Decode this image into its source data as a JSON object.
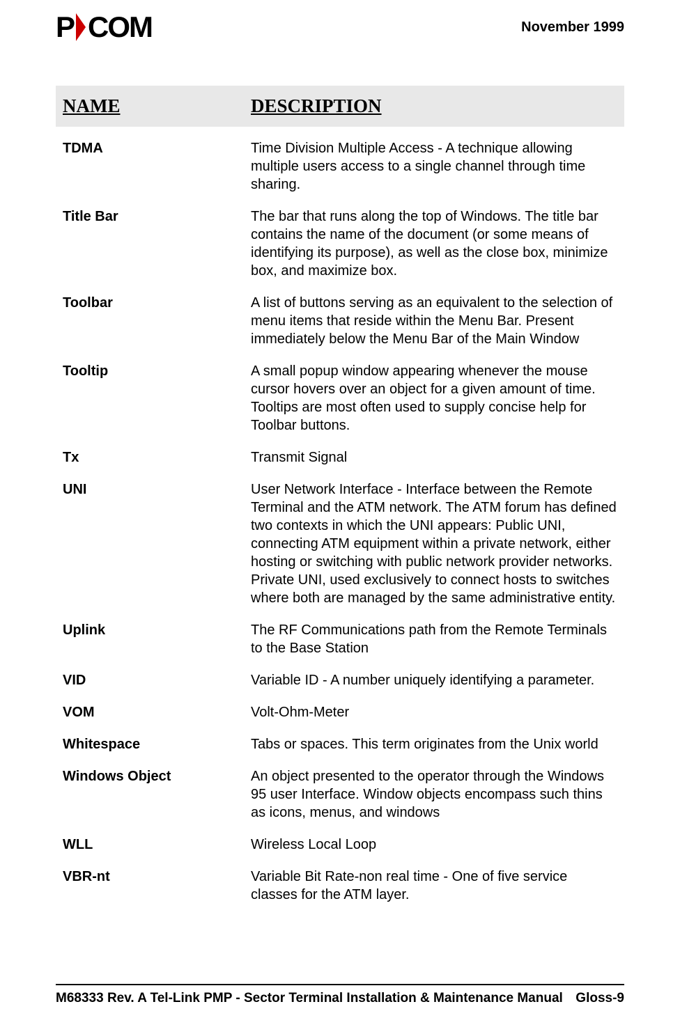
{
  "header": {
    "date": "November 1999"
  },
  "table_header": {
    "name": "NAME",
    "description": "DESCRIPTION"
  },
  "glossary": [
    {
      "term": "TDMA",
      "definition": "Time Division Multiple Access - A technique allowing multiple users access to a single channel through time sharing."
    },
    {
      "term": "Title Bar",
      "definition": "The bar that runs along the top of Windows. The title bar contains the name of the document (or some means of identifying its purpose), as well as the close box, minimize box, and maximize box."
    },
    {
      "term": "Toolbar",
      "definition": "A list of buttons serving as an equivalent to the selection of menu items that reside within the Menu Bar. Present immediately below the Menu Bar of the Main Window"
    },
    {
      "term": "Tooltip",
      "definition": "A small popup window appearing whenever the mouse cursor hovers over an object for a given amount of time. Tooltips are most often used to supply concise help for Toolbar buttons."
    },
    {
      "term": "Tx",
      "definition": "Transmit Signal"
    },
    {
      "term": "UNI",
      "definition": "User Network Interface - Interface between the Remote Terminal and the ATM network. The ATM forum has defined two contexts in which the UNI appears: Public UNI, connecting ATM equipment within a private network, either hosting or switching with public network provider networks. Private UNI, used exclusively to connect hosts to switches where both are managed by the same administrative entity."
    },
    {
      "term": "Uplink",
      "definition": "The RF Communications path from the Remote Terminals to the Base Station"
    },
    {
      "term": "VID",
      "definition": "Variable ID - A number uniquely identifying a parameter."
    },
    {
      "term": "VOM",
      "definition": "Volt-Ohm-Meter"
    },
    {
      "term": "Whitespace",
      "definition": "Tabs or spaces. This term originates from the Unix world"
    },
    {
      "term": "Windows Object",
      "definition": "An object presented to the operator through the Windows 95 user Interface. Window objects encompass such thins as icons, menus, and windows"
    },
    {
      "term": "WLL",
      "definition": "Wireless Local Loop"
    },
    {
      "term": "VBR-nt",
      "definition": "Variable Bit Rate-non real time - One of five service classes for the ATM layer."
    }
  ],
  "footer": {
    "left": "M68333 Rev. A Tel-Link PMP - Sector Terminal Installation & Maintenance Manual",
    "right": "Gloss-9"
  }
}
